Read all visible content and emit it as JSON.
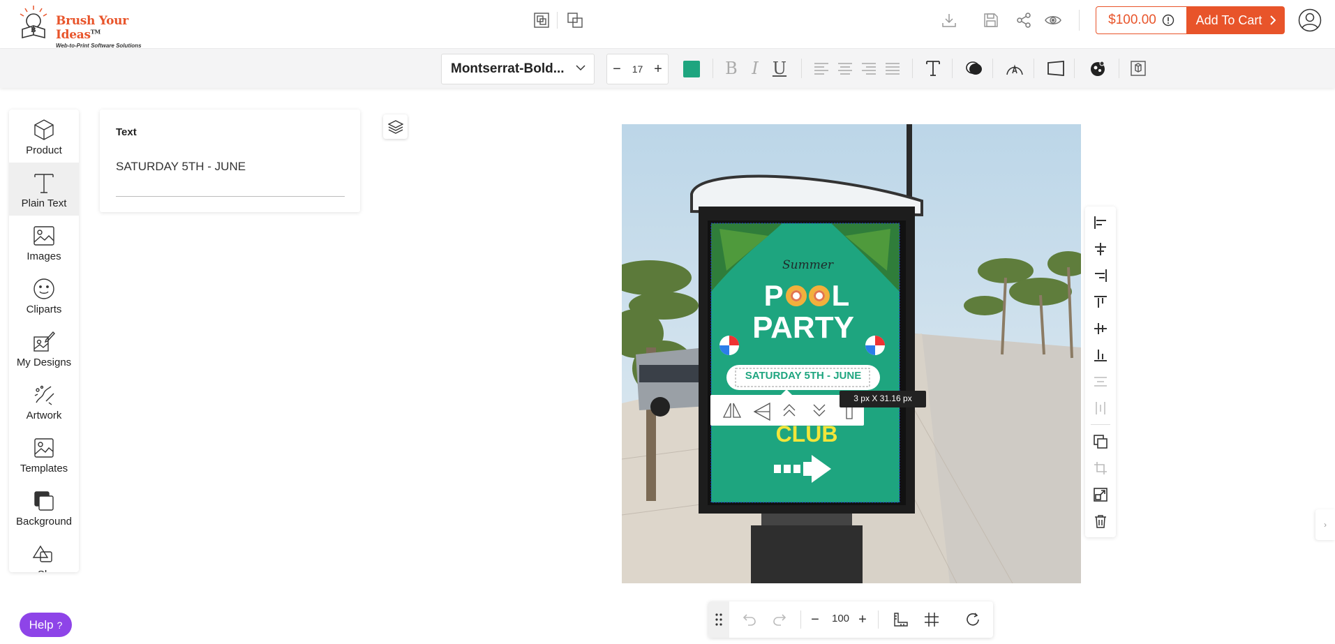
{
  "brand": {
    "name": "Brush Your Ideas",
    "tagline": "Web-to-Print Software Solutions",
    "tm": "TM"
  },
  "header": {
    "price": "$100.00",
    "add_to_cart": "Add To Cart"
  },
  "toolbar": {
    "font_name": "Montserrat-Bold...",
    "font_size": "17",
    "text_color": "#1ea57f",
    "bold_glyph": "B",
    "italic_glyph": "I",
    "underline_glyph": "U"
  },
  "sidebar": {
    "items": [
      {
        "label": "Product",
        "icon": "cube-icon"
      },
      {
        "label": "Plain Text",
        "icon": "text-icon"
      },
      {
        "label": "Images",
        "icon": "image-icon"
      },
      {
        "label": "Cliparts",
        "icon": "smiley-icon"
      },
      {
        "label": "My Designs",
        "icon": "my-designs-icon"
      },
      {
        "label": "Artwork",
        "icon": "artwork-icon"
      },
      {
        "label": "Templates",
        "icon": "templates-icon"
      },
      {
        "label": "Background",
        "icon": "background-icon"
      },
      {
        "label": "Sh",
        "icon": "shapes-icon"
      }
    ]
  },
  "text_panel": {
    "title": "Text",
    "value": "SATURDAY 5TH - JUNE"
  },
  "poster": {
    "script_title": "Summer",
    "line1_a": "P",
    "line1_b": "L",
    "line2": "PARTY",
    "date": "SATURDAY 5TH - JUNE",
    "club": "CLUB",
    "dimension_label": "3 px X 31.16 px"
  },
  "bottom_bar": {
    "zoom": "100"
  },
  "help": {
    "label": "Help",
    "glyph": "?"
  },
  "colors": {
    "accent": "#e8542a",
    "poster_green": "#1ea57f",
    "help_purple": "#8e44e8"
  }
}
